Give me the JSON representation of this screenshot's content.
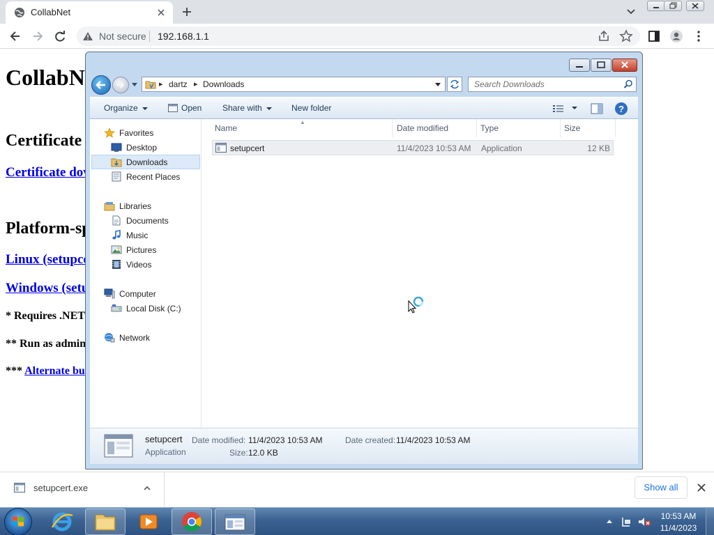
{
  "browser": {
    "tab_title": "CollabNet",
    "url_security": "Not secure",
    "url": "192.168.1.1"
  },
  "page": {
    "heading": "CollabNet",
    "section_certificate": "Certificate",
    "link_certificate": "Certificate dov",
    "section_platform": "Platform-sp",
    "link_linux": "Linux (setupce",
    "link_windows": "Windows (setu",
    "note1": "* Requires .NET",
    "note2": "** Run as admin",
    "note3_prefix": "*** ",
    "note3_link": "Alternate bu"
  },
  "explorer": {
    "breadcrumb": [
      "dartz",
      "Downloads"
    ],
    "search_placeholder": "Search Downloads",
    "commands": {
      "organize": "Organize",
      "open": "Open",
      "share_with": "Share with",
      "new_folder": "New folder"
    },
    "nav": {
      "favorites": "Favorites",
      "desktop": "Desktop",
      "downloads": "Downloads",
      "recent_places": "Recent Places",
      "libraries": "Libraries",
      "documents": "Documents",
      "music": "Music",
      "pictures": "Pictures",
      "videos": "Videos",
      "computer": "Computer",
      "local_disk": "Local Disk (C:)",
      "network": "Network"
    },
    "columns": {
      "name": "Name",
      "date_modified": "Date modified",
      "type": "Type",
      "size": "Size"
    },
    "files": [
      {
        "name": "setupcert",
        "date_modified": "11/4/2023 10:53 AM",
        "type": "Application",
        "size": "12 KB"
      }
    ],
    "details": {
      "name": "setupcert",
      "type": "Application",
      "date_modified_label": "Date modified:",
      "date_modified": "11/4/2023 10:53 AM",
      "date_created_label": "Date created:",
      "date_created": "11/4/2023 10:53 AM",
      "size_label": "Size:",
      "size": "12.0 KB"
    }
  },
  "downloads_bar": {
    "file": "setupcert.exe",
    "show_all": "Show all"
  },
  "taskbar": {
    "time": "10:53 AM",
    "date": "11/4/2023"
  }
}
